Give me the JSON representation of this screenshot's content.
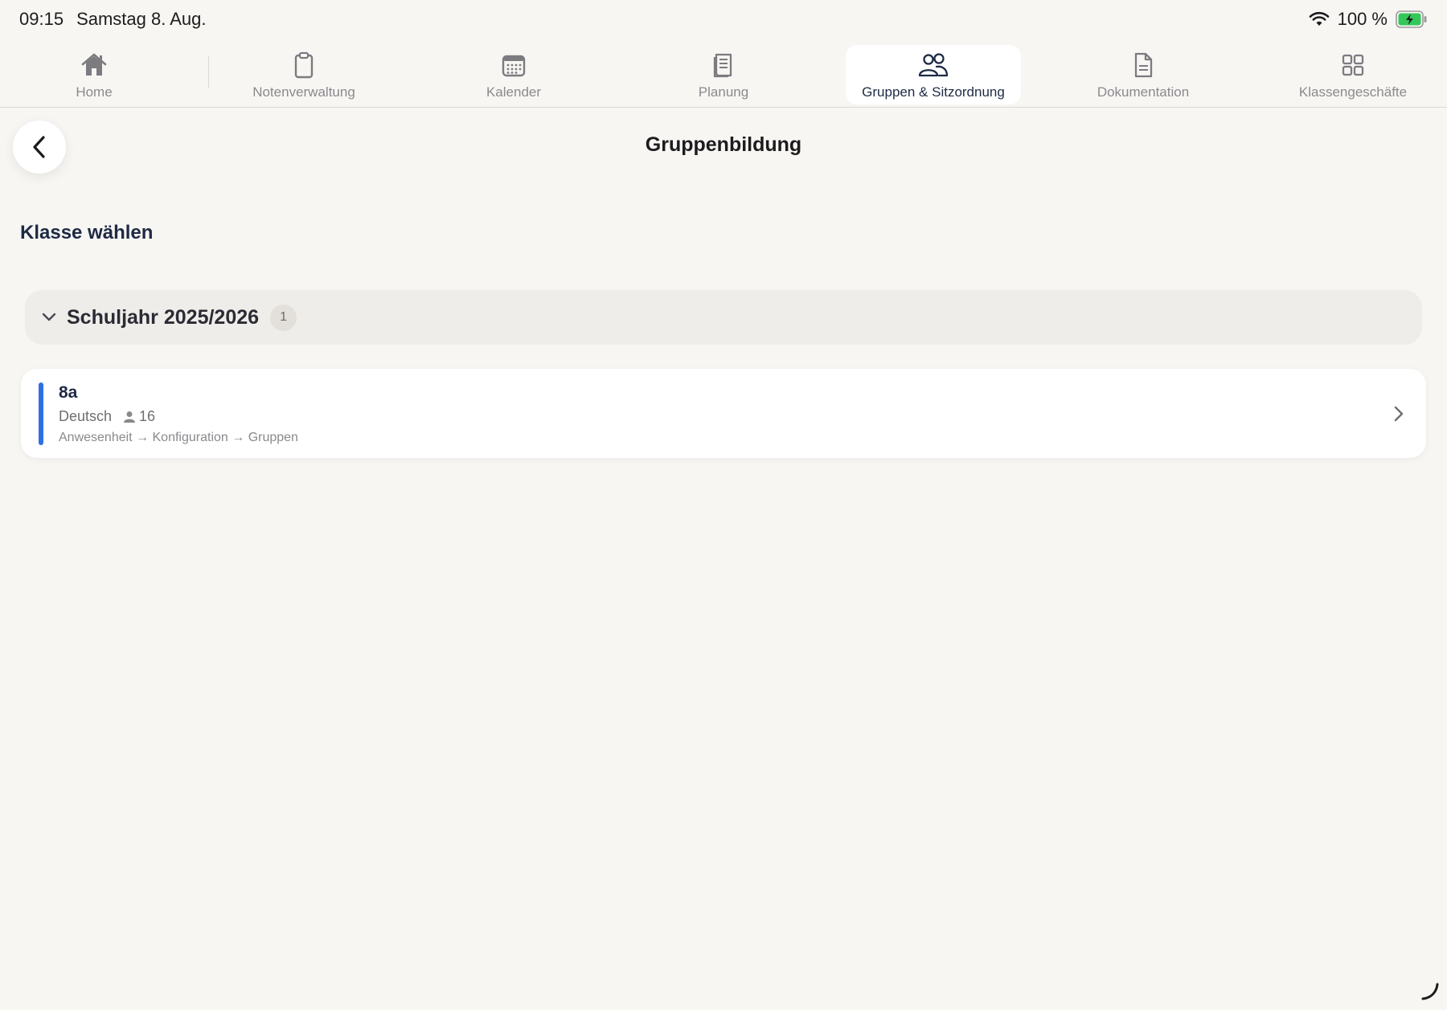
{
  "status": {
    "time": "09:15",
    "date": "Samstag 8. Aug.",
    "battery": "100 %"
  },
  "tabs": [
    {
      "label": "Home",
      "icon": "home-icon",
      "active": false
    },
    {
      "label": "Notenverwaltung",
      "icon": "clipboard-icon",
      "active": false
    },
    {
      "label": "Kalender",
      "icon": "calendar-icon",
      "active": false
    },
    {
      "label": "Planung",
      "icon": "notebook-icon",
      "active": false
    },
    {
      "label": "Gruppen & Sitzordnung",
      "icon": "people-icon",
      "active": true
    },
    {
      "label": "Dokumentation",
      "icon": "document-icon",
      "active": false
    },
    {
      "label": "Klassengeschäfte",
      "icon": "grid-icon",
      "active": false
    }
  ],
  "page": {
    "title": "Gruppenbildung",
    "section_heading": "Klasse wählen"
  },
  "group": {
    "label": "Schuljahr 2025/2026",
    "count": "1"
  },
  "class_card": {
    "name": "8a",
    "subject": "Deutsch",
    "students": "16",
    "path": "Anwesenheit → Konfiguration → Gruppen"
  },
  "colors": {
    "accent": "#2f6fe4",
    "battery": "#34c759",
    "background": "#f8f6f3"
  }
}
